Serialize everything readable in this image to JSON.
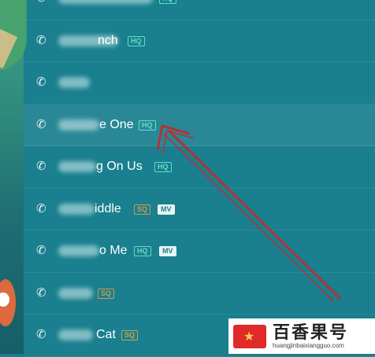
{
  "songs": [
    {
      "title": "",
      "badges": []
    },
    {
      "title": "nch",
      "badges": [
        "HQ"
      ]
    },
    {
      "title": "",
      "badges": []
    },
    {
      "title": "e One",
      "badges": [
        "HQ"
      ]
    },
    {
      "title": "g On Us",
      "badges": [
        "HQ"
      ]
    },
    {
      "title": "iddle",
      "badges": [
        "SQ",
        "MV"
      ]
    },
    {
      "title": "o Me",
      "badges": [
        "HQ",
        "MV"
      ]
    },
    {
      "title": "",
      "badges": [
        "SQ"
      ]
    },
    {
      "title": "Cat",
      "badges": [
        "SQ"
      ]
    }
  ],
  "badge_labels": {
    "HQ": "HQ",
    "SQ": "SQ",
    "MV": "MV"
  },
  "selected_index": 3,
  "top_partial_badge": "HQ",
  "watermark": {
    "chinese": "百香果号",
    "url": "huangjinbaixiangguo.com"
  },
  "colors": {
    "background": "#1a7f8e",
    "arrow": "#b0333a",
    "hq": "#5fe0c6",
    "sq": "#c9a04a"
  }
}
